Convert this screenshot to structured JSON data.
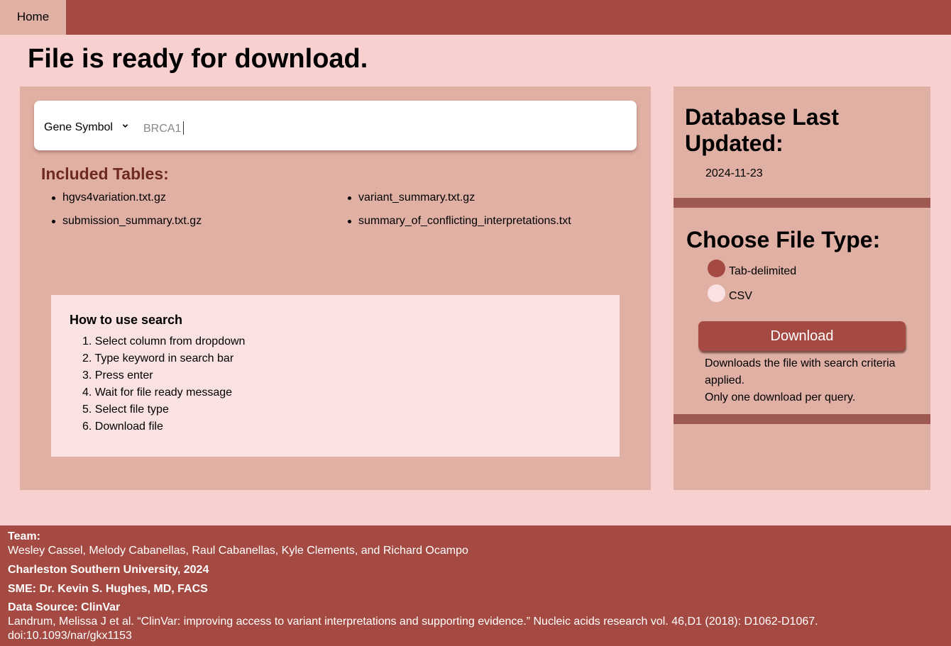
{
  "nav": {
    "home_label": "Home"
  },
  "page": {
    "title": "File is ready for download."
  },
  "search": {
    "column_select": "Gene Symbol",
    "query_value": "BRCA1"
  },
  "tables": {
    "heading": "Included Tables:",
    "items": [
      "hgvs4variation.txt.gz",
      "variant_summary.txt.gz",
      "submission_summary.txt.gz",
      "summary_of_conflicting_interpretations.txt"
    ]
  },
  "howto": {
    "title": "How to use search",
    "steps": [
      "1. Select column from dropdown",
      "2. Type keyword in search bar",
      "3. Press enter",
      "4. Wait for file ready message",
      "5. Select file type",
      "6. Download file"
    ]
  },
  "database": {
    "title": "Database Last Updated:",
    "date": "2024-11-23"
  },
  "file_type": {
    "title": "Choose File Type:",
    "options": [
      {
        "label": "Tab-delimited",
        "selected": true
      },
      {
        "label": "CSV",
        "selected": false
      }
    ]
  },
  "download": {
    "button_label": "Download",
    "note_1": "Downloads the file with search criteria applied.",
    "note_2": "Only one download per query."
  },
  "footer": {
    "team_heading": "Team:",
    "team_members": "Wesley Cassel, Melody Cabanellas, Raul Cabanellas, Kyle Clements, and Richard Ocampo",
    "university": "Charleston Southern University, 2024",
    "sme": "SME: Dr. Kevin S. Hughes, MD, FACS",
    "source_heading": "Data Source: ClinVar",
    "citation_line1": "Landrum, Melissa J et al. “ClinVar: improving access to variant interpretations and supporting evidence.” Nucleic acids research vol. 46,D1 (2018): D1062-D1067.",
    "citation_line2": "doi:10.1093/nar/gkx1153"
  },
  "colors": {
    "brand": "#a54a42",
    "background": "#f7d0cf",
    "panel": "#e0b0a5",
    "card": "#fae2e2",
    "heading_accent": "#6e2a22"
  }
}
